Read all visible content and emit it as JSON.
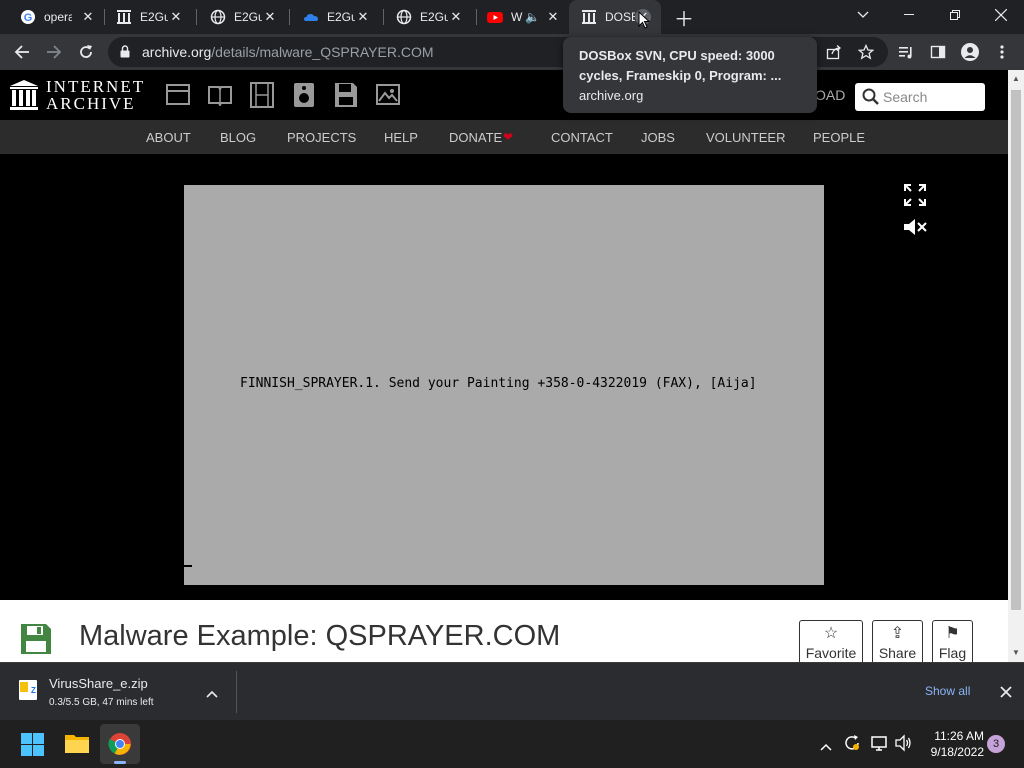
{
  "tabs": [
    {
      "label": "opera",
      "icon": "google-icon"
    },
    {
      "label": "E2Gu",
      "icon": "archive-icon"
    },
    {
      "label": "E2Gu",
      "icon": "globe-icon"
    },
    {
      "label": "E2Gu",
      "icon": "onedrive-icon"
    },
    {
      "label": "E2Gu",
      "icon": "globe-icon"
    },
    {
      "label": "W",
      "icon": "youtube-icon"
    },
    {
      "label": "DOSB",
      "icon": "archive-icon",
      "active": true
    }
  ],
  "toolbar": {
    "url_host": "archive.org",
    "url_path": "/details/malware_QSPRAYER.COM"
  },
  "tooltip": {
    "title": "DOSBox SVN, CPU speed: 3000 cycles, Frameskip 0, Program: ...",
    "host": "archive.org"
  },
  "ia": {
    "logo_line1": "INTERNET",
    "logo_line2": "ARCHIVE",
    "upload_partial": "OAD",
    "search_placeholder": "Search",
    "nav": [
      "ABOUT",
      "BLOG",
      "PROJECTS",
      "HELP",
      "DONATE",
      "CONTACT",
      "JOBS",
      "VOLUNTEER",
      "PEOPLE"
    ]
  },
  "emulator": {
    "screen_text": "FINNISH_SPRAYER.1. Send your Painting +358-0-4322019 (FAX), [Aija]"
  },
  "item": {
    "title": "Malware Example: QSPRAYER.COM",
    "favorite_label": "Favorite",
    "share_label": "Share",
    "flag_label": "Flag"
  },
  "download": {
    "filename": "VirusShare_e.zip",
    "status": "0.3/5.5 GB, 47 mins left",
    "show_all": "Show all"
  },
  "taskbar": {
    "time": "11:26 AM",
    "date": "9/18/2022",
    "notifications": "3"
  },
  "colors": {
    "accent_red": "#d0021b",
    "chrome_dark": "#202124",
    "dos_gray": "#aaaaaa",
    "ia_green": "#428641"
  }
}
